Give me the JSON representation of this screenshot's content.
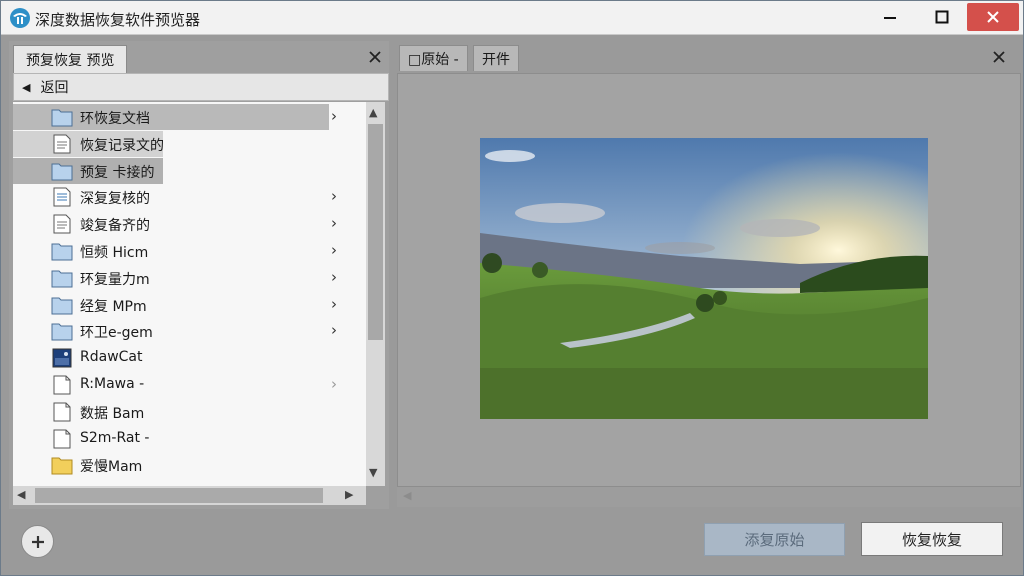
{
  "window": {
    "title": "深度数据恢复软件预览器"
  },
  "left_pane": {
    "tab_label": "预复恢复 预览",
    "back_label": "返回",
    "items": [
      {
        "label": "环恢复文档",
        "icon": "folder-icon",
        "chevron": true
      },
      {
        "label": "恢复记录文的",
        "icon": "document-icon",
        "chevron": false
      },
      {
        "label": "预复 卡接的",
        "icon": "folder-icon",
        "chevron": false
      },
      {
        "label": "深复复核的",
        "icon": "text-file-icon",
        "chevron": true
      },
      {
        "label": "竣复备齐的",
        "icon": "document-icon",
        "chevron": true
      },
      {
        "label": "恒频 Hicm",
        "icon": "folder-icon",
        "chevron": true
      },
      {
        "label": "环复量力m",
        "icon": "folder-icon",
        "chevron": true
      },
      {
        "label": "经复 MPm",
        "icon": "folder-icon",
        "chevron": true
      },
      {
        "label": "环卫e-gem",
        "icon": "folder-icon",
        "chevron": true
      },
      {
        "label": "RdawCat",
        "icon": "image-file-icon",
        "chevron": false
      },
      {
        "label": "R:Mawa -",
        "icon": "blank-file-icon",
        "chevron": true
      },
      {
        "label": "数据 Bam",
        "icon": "blank-file-icon",
        "chevron": false
      },
      {
        "label": "S2m-Rat -",
        "icon": "blank-file-icon",
        "chevron": false
      },
      {
        "label": "爱慢Mam",
        "icon": "yellow-folder-icon",
        "chevron": false
      }
    ]
  },
  "right_pane": {
    "tabs": [
      {
        "label": "□原始 -"
      },
      {
        "label": "开件"
      }
    ],
    "preview_image": "landscape-sunset-photo"
  },
  "bottom": {
    "add_icon": "plus-icon",
    "secondary_button": "添复原始",
    "primary_button": "恢复恢复"
  },
  "colors": {
    "close_button": "#d4504b",
    "disabled_button": "#a9b7c6",
    "selection": "#b9b9b9"
  }
}
